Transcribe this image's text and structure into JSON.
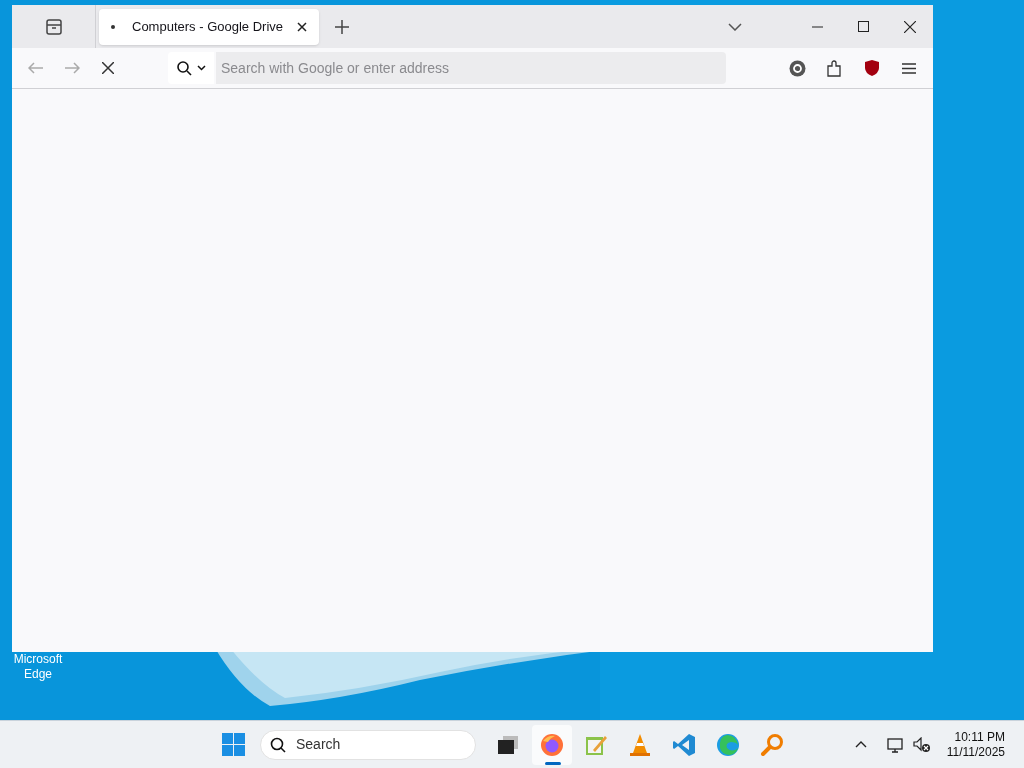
{
  "browser": {
    "tabs": [
      {
        "title": "Computers - Google Drive",
        "selected": true
      }
    ],
    "address_bar": {
      "placeholder": "Search with Google or enter address"
    },
    "loading": true
  },
  "desktop_icons": [
    {
      "label": "Microsoft Edge"
    }
  ],
  "taskbar": {
    "search": {
      "placeholder": "Search"
    },
    "apps": [
      {
        "kind": "explorer",
        "active": false
      },
      {
        "kind": "firefox",
        "active": true
      },
      {
        "kind": "notepad",
        "active": false
      },
      {
        "kind": "vlc",
        "active": false
      },
      {
        "kind": "vscode",
        "active": false
      },
      {
        "kind": "edge",
        "active": false
      },
      {
        "kind": "magnifier",
        "active": false
      }
    ],
    "clock": {
      "time": "10:11 PM",
      "date": "11/11/2025"
    }
  }
}
